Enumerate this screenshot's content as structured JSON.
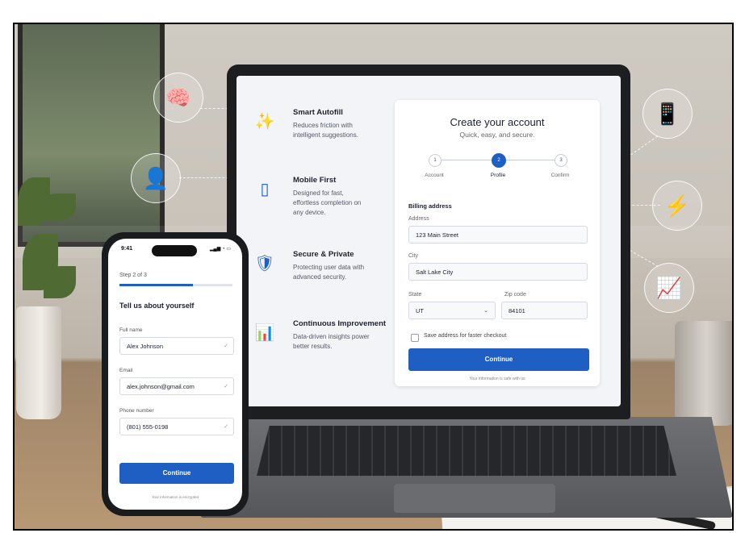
{
  "features": [
    {
      "icon": "magic-wand-icon",
      "glyph": "✨",
      "title": "Smart Autofill",
      "desc": "Reduces friction with intelligent suggestions."
    },
    {
      "icon": "mobile-icon",
      "glyph": "▯",
      "title": "Mobile First",
      "desc": "Designed for fast, effortless completion on any device."
    },
    {
      "icon": "shield-check-icon",
      "glyph": "🛡",
      "title": "Secure & Private",
      "desc": "Protecting user data with advanced security."
    },
    {
      "icon": "bar-chart-icon",
      "glyph": "📊",
      "title": "Continuous Improvement",
      "desc": "Data-driven insights power better results."
    }
  ],
  "form": {
    "title": "Create your account",
    "subtitle": "Quick, easy, and secure.",
    "steps": [
      {
        "num": "1",
        "label": "Account"
      },
      {
        "num": "2",
        "label": "Profile"
      },
      {
        "num": "3",
        "label": "Confirm"
      }
    ],
    "section": "Billing address",
    "address_label": "Address",
    "address_value": "123 Main Street",
    "city_label": "City",
    "city_value": "Salt Lake City",
    "state_label": "State",
    "state_value": "UT",
    "zip_label": "Zip code",
    "zip_value": "84101",
    "save_label": "Save address for faster checkout",
    "continue_label": "Continue",
    "footnote": "Your information is safe with us"
  },
  "phone": {
    "time": "9:41",
    "status": "▂▄▆ ◔ ▭",
    "step": "Step 2 of 3",
    "progress": 0.65,
    "title": "Tell us about yourself",
    "name_label": "Full name",
    "name_value": "Alex Johnson",
    "email_label": "Email",
    "email_value": "alex.johnson@gmail.com",
    "phone_label": "Phone number",
    "phone_value": "(801) 555-0198",
    "continue_label": "Continue",
    "footnote": "Your information is encrypted"
  },
  "floating_icons": [
    {
      "name": "brain-icon",
      "glyph": "🧠"
    },
    {
      "name": "user-check-icon",
      "glyph": "👤"
    },
    {
      "name": "smartphone-icon",
      "glyph": "📱"
    },
    {
      "name": "lightning-icon",
      "glyph": "⚡"
    },
    {
      "name": "growth-chart-icon",
      "glyph": "📈"
    }
  ]
}
